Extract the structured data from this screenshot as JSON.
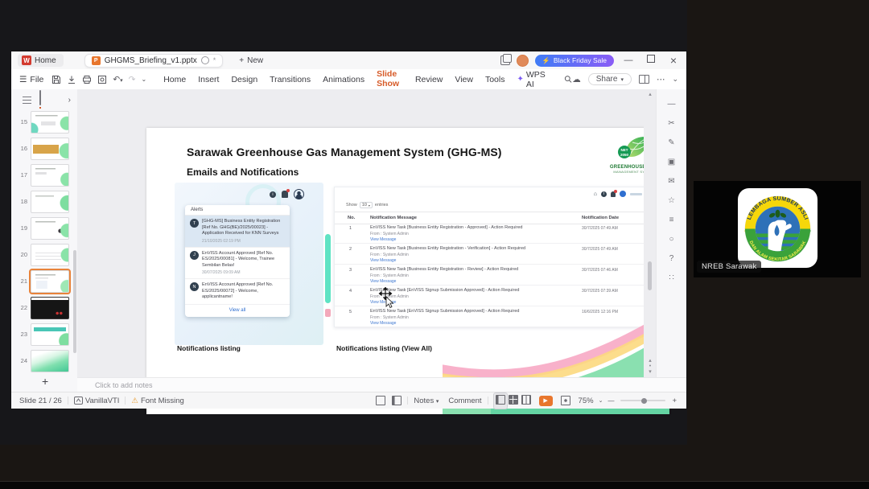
{
  "icons": {
    "lightning": "⚡",
    "warning": "⚠",
    "plus": "+",
    "chevron_down": "⌄",
    "caret_down": "▾",
    "ellipsis": "⋯",
    "hamburger": "☰",
    "undo": "↶",
    "redo": "↷",
    "cloud": "☁",
    "sparkle": "✦",
    "chevron_right": "›",
    "play": "▶",
    "minimize": "—",
    "close": "×",
    "home": "⌂",
    "up_arrow": "▴",
    "down_arrow": "▾",
    "unsaved": "*"
  },
  "meeting": {
    "participant": {
      "name": "NREB Sarawak"
    },
    "logo": {
      "top_text": "LEMBAGA SUMBER ASLI",
      "bottom_text": "DAN ALAM SEKITAR SARAWAK"
    }
  },
  "titlebar": {
    "home_tab": "Home",
    "doc_tab": "GHGMS_Briefing_v1.pptx",
    "new_tab": "New",
    "promo": "Black Friday Sale",
    "wps_logo": "W",
    "ppt_logo": "P"
  },
  "ribbon": {
    "file": "File",
    "tabs": [
      {
        "label": "Home"
      },
      {
        "label": "Insert"
      },
      {
        "label": "Design"
      },
      {
        "label": "Transitions"
      },
      {
        "label": "Animations"
      },
      {
        "label": "Slide Show",
        "active": true
      },
      {
        "label": "Review"
      },
      {
        "label": "View"
      },
      {
        "label": "Tools"
      }
    ],
    "wps_ai": "WPS AI",
    "share": "Share"
  },
  "side_icons": [
    {
      "name": "collapse",
      "glyph": "—"
    },
    {
      "name": "format-tools",
      "glyph": "✂"
    },
    {
      "name": "ai-assistant",
      "glyph": "✎"
    },
    {
      "name": "shapes",
      "glyph": "▣"
    },
    {
      "name": "comment-panel",
      "glyph": "✉"
    },
    {
      "name": "favorites",
      "glyph": "☆"
    },
    {
      "name": "settings",
      "glyph": "≡"
    },
    {
      "name": "history",
      "glyph": "○"
    },
    {
      "name": "help",
      "glyph": "?"
    },
    {
      "name": "apps",
      "glyph": "∷"
    }
  ],
  "thumbnails": {
    "slides": [
      {
        "num": "15",
        "variant": "v15"
      },
      {
        "num": "16",
        "variant": "v16"
      },
      {
        "num": "17",
        "variant": "v17"
      },
      {
        "num": "18",
        "variant": "v18"
      },
      {
        "num": "19",
        "variant": "v19"
      },
      {
        "num": "20",
        "variant": "v20"
      },
      {
        "num": "21",
        "variant": "v21",
        "selected": true
      },
      {
        "num": "22",
        "variant": "v22"
      },
      {
        "num": "23",
        "variant": "v23"
      },
      {
        "num": "24",
        "variant": "v24"
      }
    ]
  },
  "slide": {
    "title": "Sarawak Greenhouse Gas Management System (GHG-MS)",
    "subtitle": "Emails and Notifications",
    "logo": {
      "badge_line1": "NET",
      "badge_line2": "2050",
      "name_line1": "GREENHOUSE GAS",
      "name_line2": "MANAGEMENT SYSTEM"
    },
    "captions": {
      "left": "Notifications listing",
      "right": "Notifications listing (View All)"
    },
    "alerts": {
      "title": "Alerts",
      "items": [
        {
          "initial": "T",
          "text": "[GHG-MS] Business Entity Registration [Ref No. GHG(BE)/2025/00023] - Application Received for KNN Surveys",
          "time": "21/10/2025 02:19 PM",
          "highlight": true
        },
        {
          "initial": "J",
          "text": "EnVISS Account Approved [Ref No. ES/2025/00081] - Welcome, Trainee Sembilan Belas!",
          "time": "30/07/2025 09:09 AM"
        },
        {
          "initial": "N",
          "text": "EnVISS Account Approved [Ref No. ES/2025/00072] - Welcome, applicantname!",
          "time": ""
        }
      ],
      "view_all": "View all"
    },
    "table": {
      "show": "Show",
      "page_size": "10",
      "entries": "entries",
      "headers": {
        "no": "No.",
        "message": "Notification Message",
        "date": "Notification Date"
      },
      "rows": [
        {
          "no": "1",
          "message": "EnVISS New Task [Business Entity Registration - Approved] - Action Required",
          "from": "From : System Admin",
          "link": "View Message",
          "date": "30/7/2025 07:49 AM"
        },
        {
          "no": "2",
          "message": "EnVISS New Task [Business Entity Registration - Verification] - Action Required",
          "from": "From : System Admin",
          "link": "View Message",
          "date": "30/7/2025 07:49 AM"
        },
        {
          "no": "3",
          "message": "EnVISS New Task [Business Entity Registration - Review] - Action Required",
          "from": "From : System Admin",
          "link": "View Message",
          "date": "30/7/2025 07:46 AM"
        },
        {
          "no": "4",
          "message": "EnVISS New Task [EnVISS Signup Submission Approved] - Action Required",
          "from": "From : System Admin",
          "link": "View Message",
          "date": "30/7/2025 07:39 AM"
        },
        {
          "no": "5",
          "message": "EnVISS New Task [EnVISS Signup Submission Approved] - Action Required",
          "from": "From : System Admin",
          "link": "View Message",
          "date": "16/6/2025 12:16 PM"
        }
      ]
    }
  },
  "notes": {
    "placeholder": "Click to add notes"
  },
  "statusbar": {
    "slide_indicator": "Slide 21 / 26",
    "theme": "VanillaVTI",
    "font_missing": "Font Missing",
    "notes": "Notes",
    "comment": "Comment",
    "zoom": "75%"
  },
  "colors": {
    "accent_orange": "#d75b28",
    "promo_start": "#3f7cf6",
    "promo_end": "#8a5cf6",
    "teal": "#5fe3c4",
    "link_blue": "#3f78d1"
  }
}
